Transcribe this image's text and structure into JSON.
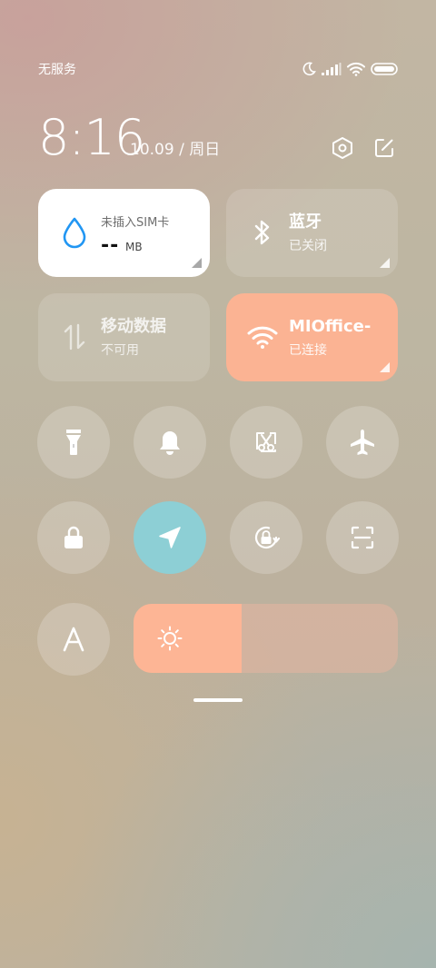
{
  "status_bar": {
    "carrier": "无服务",
    "icons": [
      "moon-icon",
      "signal-icon",
      "wifi-icon",
      "battery-icon"
    ]
  },
  "header": {
    "time": "8:16",
    "date": "10.09 / 周日",
    "settings_icon": "settings-hexagon-icon",
    "edit_icon": "edit-icon"
  },
  "tiles": {
    "sim": {
      "title": "未插入SIM卡",
      "value": "--",
      "unit": "MB",
      "icon": "water-drop-icon",
      "accent": "#2196f3"
    },
    "bluetooth": {
      "title": "蓝牙",
      "status": "已关闭",
      "icon": "bluetooth-icon"
    },
    "mobile_data": {
      "title": "移动数据",
      "status": "不可用",
      "icon": "mobile-data-arrows-icon"
    },
    "wifi": {
      "title": "MIOffice-",
      "status": "已连接",
      "icon": "wifi-icon",
      "accent": "#fbb393"
    }
  },
  "toggles": [
    {
      "name": "flashlight",
      "icon": "flashlight-icon",
      "active": false
    },
    {
      "name": "ring",
      "icon": "bell-icon",
      "active": false
    },
    {
      "name": "screenshot",
      "icon": "scissors-icon",
      "active": false
    },
    {
      "name": "airplane-mode",
      "icon": "airplane-icon",
      "active": false
    },
    {
      "name": "lock-screen",
      "icon": "lock-icon",
      "active": false
    },
    {
      "name": "location",
      "icon": "location-arrow-icon",
      "active": true,
      "accent": "#8dcfd5"
    },
    {
      "name": "rotation-lock",
      "icon": "rotation-lock-icon",
      "active": false
    },
    {
      "name": "scanner",
      "icon": "scan-icon",
      "active": false
    },
    {
      "name": "font-size",
      "icon": "font-a-icon",
      "active": false
    }
  ],
  "brightness": {
    "level": 0.41,
    "icon": "sun-icon",
    "accent": "#fdb595"
  }
}
